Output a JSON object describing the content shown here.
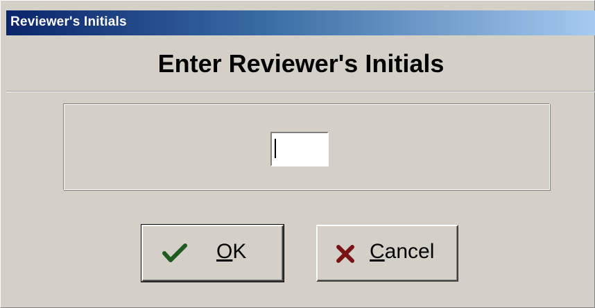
{
  "window": {
    "title": "Reviewer's Initials"
  },
  "header": {
    "heading": "Enter Reviewer's Initials"
  },
  "form": {
    "initials_value": "",
    "initials_placeholder": ""
  },
  "buttons": {
    "ok": {
      "mnemonic": "O",
      "rest": "K",
      "icon": "checkmark-icon",
      "icon_color": "#1f5a1f"
    },
    "cancel": {
      "mnemonic": "C",
      "rest": "ancel",
      "icon": "x-icon",
      "icon_color": "#7a1414"
    }
  },
  "colors": {
    "title_gradient_start": "#0a246a",
    "title_gradient_end": "#a6caf0",
    "dialog_bg": "#d4d0c8"
  }
}
